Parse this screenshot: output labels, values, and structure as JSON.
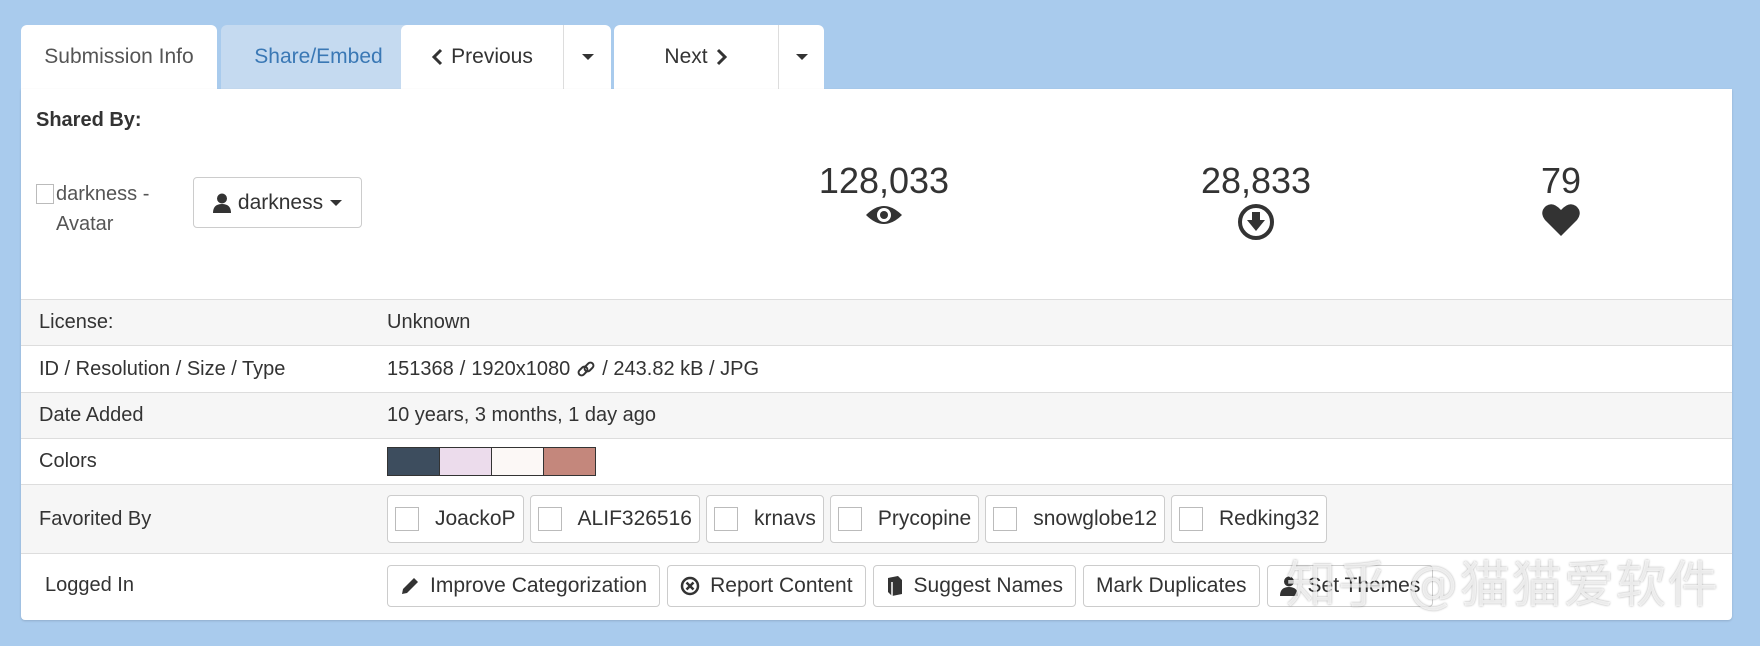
{
  "tabs": {
    "submission_info": "Submission Info",
    "share_embed": "Share/Embed",
    "previous": "Previous",
    "next": "Next"
  },
  "shared_by": {
    "heading": "Shared By:",
    "avatar_alt": "darkness - Avatar",
    "username": "darkness"
  },
  "stats": {
    "views": "128,033",
    "downloads": "28,833",
    "favorites": "79"
  },
  "info": {
    "license_label": "License:",
    "license_value": "Unknown",
    "id_label": "ID / Resolution / Size / Type",
    "id_value": "151368",
    "resolution_value": "1920x1080",
    "size_type_value": "/ 243.82 kB / JPG",
    "date_label": "Date Added",
    "date_value": "10 years, 3 months, 1 day ago",
    "colors_label": "Colors",
    "colors": [
      "#3d4d5e",
      "#ecdcec",
      "#fcf8f6",
      "#c4877c"
    ],
    "favorited_label": "Favorited By",
    "favorited_by": [
      "JoackoP",
      "ALIF326516",
      "krnavs",
      "Prycopine",
      "snowglobe12",
      "Redking32"
    ],
    "logged_label": "Logged In"
  },
  "actions": {
    "improve": "Improve Categorization",
    "report": "Report Content",
    "suggest": "Suggest Names",
    "duplicates": "Mark Duplicates",
    "themes": "Set Themes"
  },
  "watermark": "知乎 @猫猫爱软件",
  "icons": [
    "eye-icon",
    "download-circle-icon",
    "heart-icon",
    "user-icon",
    "link-icon",
    "pencil-icon",
    "report-icon",
    "book-icon",
    "chevron-left-icon",
    "chevron-right-icon",
    "caret-down-icon"
  ]
}
